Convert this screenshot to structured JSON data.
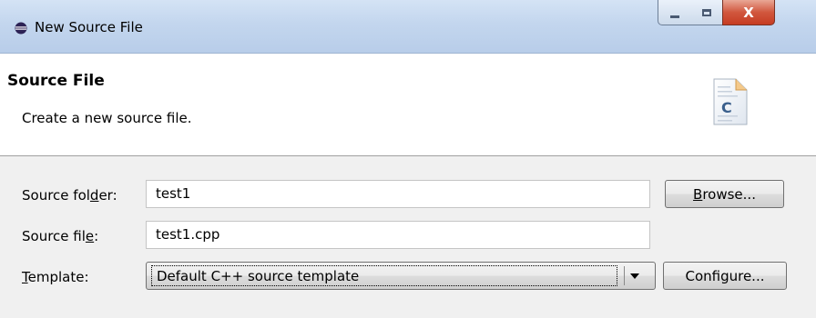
{
  "window": {
    "title": "New Source File",
    "controls": {
      "minimize_icon": "minimize-icon",
      "maximize_icon": "maximize-icon",
      "close_glyph": "X"
    }
  },
  "header": {
    "title": "Source File",
    "description": "Create a new source file.",
    "icon": "c-source-file-icon",
    "icon_letter": "C"
  },
  "form": {
    "source_folder": {
      "label_pre": "Source fol",
      "label_mnemonic": "d",
      "label_post": "er:",
      "value": "test1",
      "button_mnemonic": "B",
      "button_rest": "rowse..."
    },
    "source_file": {
      "label_pre": "Source fil",
      "label_mnemonic": "e",
      "label_post": ":",
      "value": "test1.cpp"
    },
    "template": {
      "label_mnemonic": "T",
      "label_rest": "emplate:",
      "selected": "Default C++ source template",
      "button": "Configure..."
    }
  },
  "colors": {
    "titlebar": "#c3d6ee",
    "close_button": "#c63c22",
    "dialog_background": "#f0f0f0",
    "banner_background": "#ffffff"
  }
}
